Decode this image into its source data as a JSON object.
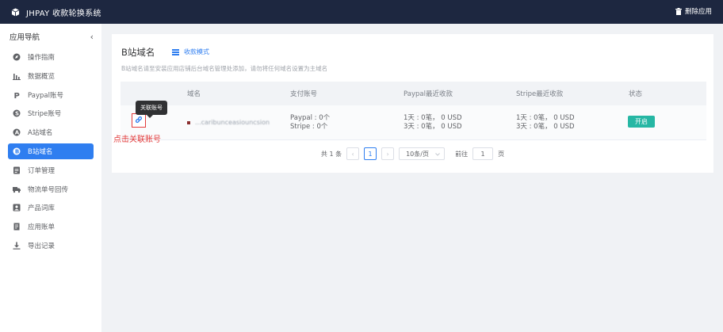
{
  "topbar": {
    "title": "JHPAY 收款轮换系统",
    "delete_app": "删除应用"
  },
  "sidebar": {
    "heading": "应用导航",
    "collapse_icon": "‹",
    "items": [
      {
        "label": "操作指南",
        "icon": "guide-icon"
      },
      {
        "label": "数据概览",
        "icon": "bar-chart-icon"
      },
      {
        "label": "Paypal账号",
        "icon": "paypal-icon"
      },
      {
        "label": "Stripe账号",
        "icon": "stripe-icon"
      },
      {
        "label": "A站域名",
        "icon": "a-site-icon"
      },
      {
        "label": "B站域名",
        "icon": "b-site-icon",
        "active": true
      },
      {
        "label": "订单管理",
        "icon": "order-icon"
      },
      {
        "label": "物流单号回传",
        "icon": "truck-icon"
      },
      {
        "label": "产品词库",
        "icon": "product-icon"
      },
      {
        "label": "应用账单",
        "icon": "bill-icon"
      },
      {
        "label": "导出记录",
        "icon": "download-icon"
      }
    ]
  },
  "main": {
    "title": "B站域名",
    "mode_link": "收款模式",
    "hint": "B站域名请至安装应用店铺后台域名管理处添加，请勿将任何域名设置为主域名",
    "columns": [
      "域名",
      "支付账号",
      "Paypal最近收款",
      "Stripe最近收款",
      "状态"
    ],
    "rows": [
      {
        "domain": "...caribunceasiouncsion",
        "pay_accounts": [
          "Paypal : 0个",
          "Stripe : 0个"
        ],
        "paypal_recent": [
          "1天 : 0笔，  0 USD",
          "3天 : 0笔，  0 USD"
        ],
        "stripe_recent": [
          "1天 : 0笔，  0 USD",
          "3天 : 0笔，  0 USD"
        ],
        "status": "开启"
      }
    ],
    "tooltip": "关联账号",
    "annotation": "点击关联账号"
  },
  "pagination": {
    "total": "共 1 条",
    "prev": "‹",
    "current_page": "1",
    "next": "›",
    "page_size": "10条/页",
    "goto_label": "前往",
    "goto_value": "1",
    "page_suffix": "页"
  },
  "colors": {
    "topbar": "#1d2740",
    "accent": "#2f7ef0",
    "status_on": "#26b7a4",
    "annotation_red": "#e23a3a"
  }
}
